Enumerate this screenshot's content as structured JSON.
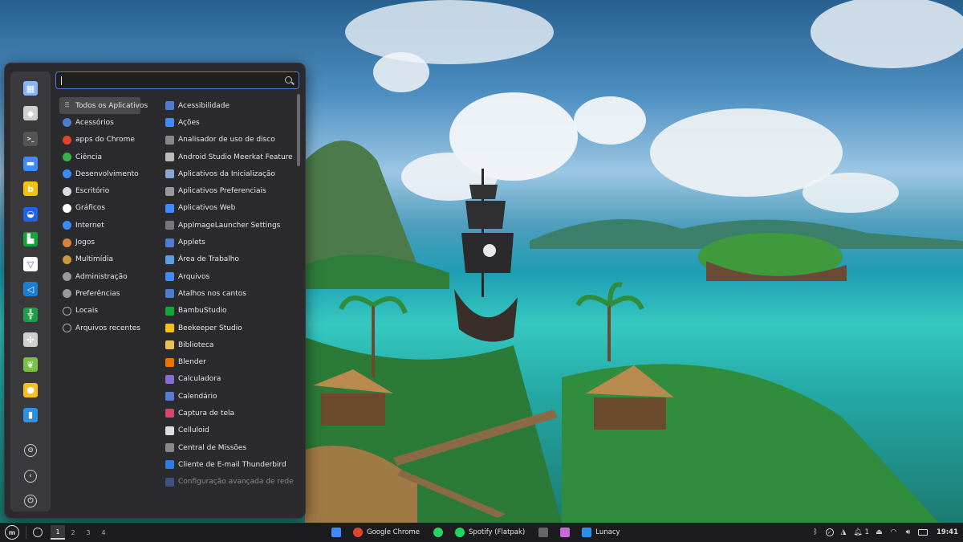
{
  "search": {
    "value": "",
    "placeholder": ""
  },
  "favorites": [
    {
      "icon": "software-store-icon",
      "color": "#8ab4f8"
    },
    {
      "icon": "settings-icon",
      "color": "#cfcfcf"
    },
    {
      "icon": "terminal-icon",
      "color": "#555"
    },
    {
      "icon": "folder-icon",
      "color": "#3d8bfd"
    },
    {
      "icon": "beekeeper-icon",
      "color": "#f4c20d"
    },
    {
      "icon": "docker-icon",
      "color": "#1d63ed"
    },
    {
      "icon": "bambu-icon",
      "color": "#13a538"
    },
    {
      "icon": "proton-vpn-icon",
      "color": "#fff"
    },
    {
      "icon": "vscode-icon",
      "color": "#1a7fd4"
    },
    {
      "icon": "table-app-icon",
      "color": "#1e9e4a"
    },
    {
      "icon": "pinwheel-icon",
      "color": "#cfcfcf"
    },
    {
      "icon": "mint-leaf-icon",
      "color": "#7ac143"
    },
    {
      "icon": "keep-icon",
      "color": "#f6bf26"
    },
    {
      "icon": "lunacy-icon",
      "color": "#2d8fe6"
    }
  ],
  "system_buttons": [
    {
      "icon": "lock-icon"
    },
    {
      "icon": "logout-icon"
    },
    {
      "icon": "power-icon"
    }
  ],
  "categories": [
    {
      "label": "Todos os Aplicativos",
      "icon": "grid-icon",
      "color": "#bbb",
      "selected": true
    },
    {
      "label": "Acessórios",
      "icon": "accessories-icon",
      "color": "#4f7bd1"
    },
    {
      "label": "apps do Chrome",
      "icon": "chrome-icon",
      "color": "#e0452b"
    },
    {
      "label": "Ciência",
      "icon": "science-icon",
      "color": "#36b04b"
    },
    {
      "label": "Desenvolvimento",
      "icon": "development-icon",
      "color": "#3d8bfd"
    },
    {
      "label": "Escritório",
      "icon": "office-icon",
      "color": "#ddd"
    },
    {
      "label": "Gráficos",
      "icon": "graphics-icon",
      "color": "#fff"
    },
    {
      "label": "Internet",
      "icon": "internet-icon",
      "color": "#3d8bfd"
    },
    {
      "label": "Jogos",
      "icon": "games-icon",
      "color": "#d9823b"
    },
    {
      "label": "Multimídia",
      "icon": "multimedia-icon",
      "color": "#c79a3a"
    },
    {
      "label": "Administração",
      "icon": "administration-icon",
      "color": "#999"
    },
    {
      "label": "Preferências",
      "icon": "preferences-icon",
      "color": "#999"
    },
    {
      "label": "Locais",
      "icon": "places-icon",
      "color": "#aaa"
    },
    {
      "label": "Arquivos recentes",
      "icon": "recent-icon",
      "color": "#aaa"
    }
  ],
  "apps": [
    {
      "label": "Acessibilidade",
      "icon": "accessibility-icon",
      "color": "#4f7bd1"
    },
    {
      "label": "Ações",
      "icon": "actions-icon",
      "color": "#3d8bfd"
    },
    {
      "label": "Analisador de uso de disco",
      "icon": "disk-usage-icon",
      "color": "#888"
    },
    {
      "label": "Android Studio Meerkat Feature ...",
      "icon": "android-studio-icon",
      "color": "#bbb"
    },
    {
      "label": "Aplicativos da Inicialização",
      "icon": "startup-apps-icon",
      "color": "#8aa4d6"
    },
    {
      "label": "Aplicativos Preferenciais",
      "icon": "preferred-apps-icon",
      "color": "#999"
    },
    {
      "label": "Aplicativos Web",
      "icon": "web-apps-icon",
      "color": "#3d8bfd"
    },
    {
      "label": "AppImageLauncher Settings",
      "icon": "appimage-icon",
      "color": "#777"
    },
    {
      "label": "Applets",
      "icon": "applets-icon",
      "color": "#4f7bd1"
    },
    {
      "label": "Área de Trabalho",
      "icon": "desktop-icon",
      "color": "#5aa0e6"
    },
    {
      "label": "Arquivos",
      "icon": "files-icon",
      "color": "#3d8bfd"
    },
    {
      "label": "Atalhos nos cantos",
      "icon": "hot-corners-icon",
      "color": "#4f7bd1"
    },
    {
      "label": "BambuStudio",
      "icon": "bambu-icon",
      "color": "#13a538"
    },
    {
      "label": "Beekeeper Studio",
      "icon": "beekeeper-icon",
      "color": "#f4c20d"
    },
    {
      "label": "Biblioteca",
      "icon": "library-icon",
      "color": "#e8c15a"
    },
    {
      "label": "Blender",
      "icon": "blender-icon",
      "color": "#ea7600"
    },
    {
      "label": "Calculadora",
      "icon": "calculator-icon",
      "color": "#8a6bd6"
    },
    {
      "label": "Calendário",
      "icon": "calendar-icon",
      "color": "#5a78d6"
    },
    {
      "label": "Captura de tela",
      "icon": "screenshot-icon",
      "color": "#d6456b"
    },
    {
      "label": "Celluloid",
      "icon": "celluloid-icon",
      "color": "#ddd"
    },
    {
      "label": "Central de Missões",
      "icon": "mission-center-icon",
      "color": "#888"
    },
    {
      "label": "Cliente de E-mail Thunderbird",
      "icon": "thunderbird-icon",
      "color": "#2d7be6"
    },
    {
      "label": "Configuração avançada de rede",
      "icon": "network-config-icon",
      "color": "#4f7bd1",
      "dim": true
    }
  ],
  "taskbar": {
    "workspaces": [
      "1",
      "2",
      "3",
      "4"
    ],
    "active_workspace": "1",
    "tasks": [
      {
        "label": "",
        "icon": "files-icon",
        "color": "#3d8bfd"
      },
      {
        "label": "Google Chrome",
        "icon": "chrome-icon",
        "color": "#e0452b"
      },
      {
        "label": "",
        "icon": "whatsapp-icon",
        "color": "#25d366"
      },
      {
        "label": "Spotify (Flatpak)",
        "icon": "spotify-icon",
        "color": "#1ed760"
      },
      {
        "label": "",
        "icon": "editor-icon",
        "color": "#666"
      },
      {
        "label": "",
        "icon": "screen-recorder-icon",
        "color": "#c66bd6"
      },
      {
        "label": "Lunacy",
        "icon": "lunacy-icon",
        "color": "#2d8fe6"
      }
    ],
    "tray": {
      "notification_count": "1",
      "clock": "19:41"
    }
  }
}
